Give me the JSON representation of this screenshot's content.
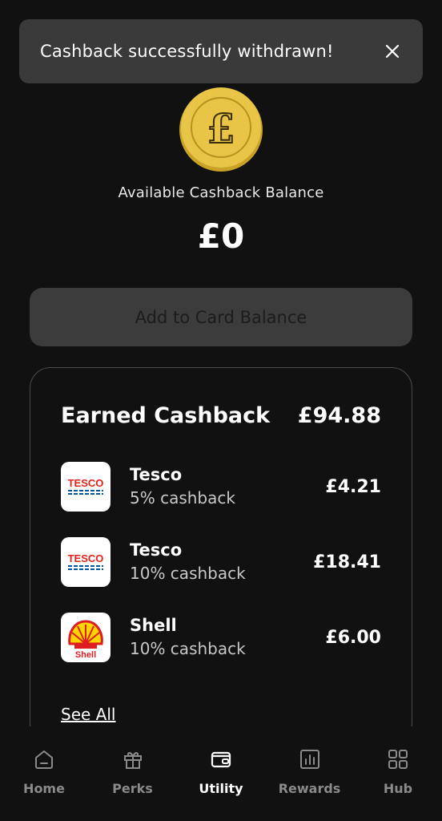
{
  "toast": {
    "message": "Cashback successfully withdrawn!",
    "close_icon": "close-icon"
  },
  "balance": {
    "label": "Available Cashback Balance",
    "value": "£0",
    "coin_icon": "pound-coin-icon",
    "coin_symbol": "£"
  },
  "add_button": {
    "label": "Add to Card Balance"
  },
  "earned": {
    "title": "Earned Cashback",
    "total": "£94.88",
    "items": [
      {
        "name": "Tesco",
        "rate": "5% cashback",
        "amount": "£4.21",
        "logo": "tesco-logo",
        "logo_text": "TESCO"
      },
      {
        "name": "Tesco",
        "rate": "10% cashback",
        "amount": "£18.41",
        "logo": "tesco-logo",
        "logo_text": "TESCO"
      },
      {
        "name": "Shell",
        "rate": "10% cashback",
        "amount": "£6.00",
        "logo": "shell-logo",
        "logo_text": "Shell"
      }
    ],
    "see_all": "See All"
  },
  "nav": {
    "items": [
      {
        "label": "Home",
        "icon": "home-icon",
        "active": false
      },
      {
        "label": "Perks",
        "icon": "gift-icon",
        "active": false
      },
      {
        "label": "Utility",
        "icon": "wallet-icon",
        "active": true
      },
      {
        "label": "Rewards",
        "icon": "chart-icon",
        "active": false
      },
      {
        "label": "Hub",
        "icon": "grid-icon",
        "active": false
      }
    ]
  },
  "colors": {
    "background": "#111111",
    "toast": "#3a3a3a",
    "button_disabled": "#3c3c3c",
    "coin_gold": "#e8c547",
    "tesco_red": "#e2231a",
    "tesco_blue": "#00539f",
    "shell_yellow": "#ffd500",
    "shell_red": "#dd1d21",
    "nav_inactive": "#8a8a8a"
  }
}
